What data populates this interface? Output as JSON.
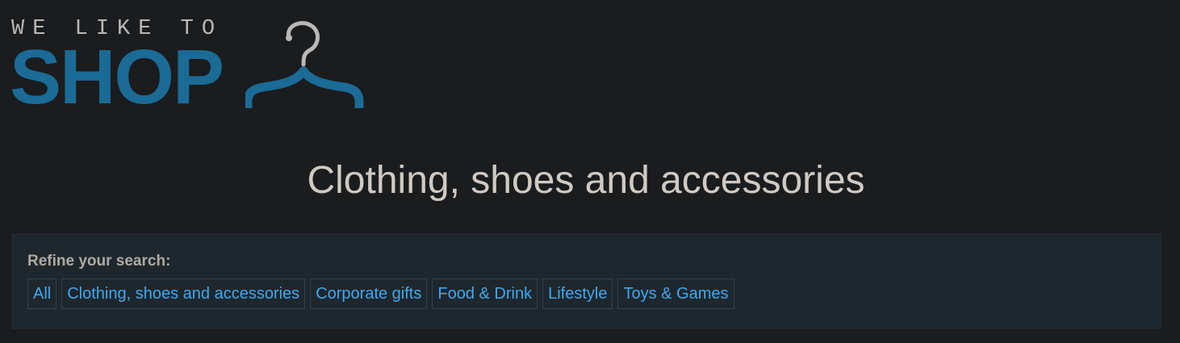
{
  "logo": {
    "tagline": "WE LIKE TO",
    "word": "SHOP",
    "icon": "hanger-icon",
    "color": "#1a6b96"
  },
  "page_title": "Clothing, shoes and accessories",
  "refine": {
    "label": "Refine your search:",
    "links": [
      "All",
      "Clothing, shoes and accessories",
      "Corporate gifts",
      "Food & Drink",
      "Lifestyle",
      "Toys & Games"
    ],
    "link_color": "#3ea9f0"
  }
}
